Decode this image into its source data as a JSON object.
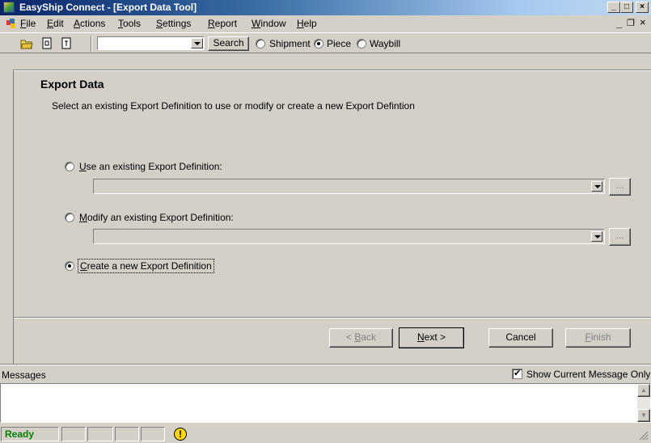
{
  "window": {
    "title": "EasyShip Connect - [Export Data Tool]"
  },
  "menu": {
    "items": [
      {
        "label": "File",
        "u": "F",
        "rest": "ile"
      },
      {
        "label": "Edit",
        "u": "E",
        "rest": "dit"
      },
      {
        "label": "Actions",
        "u": "A",
        "rest": "ctions"
      },
      {
        "label": "Tools",
        "u": "T",
        "rest": "ools"
      },
      {
        "label": "Settings",
        "u": "S",
        "rest": "ettings"
      },
      {
        "label": "Report",
        "u": "R",
        "rest": "eport"
      },
      {
        "label": "Window",
        "u": "W",
        "rest": "indow"
      },
      {
        "label": "Help",
        "u": "H",
        "rest": "elp"
      }
    ]
  },
  "toolbar": {
    "search_value": "",
    "search_label": "Search",
    "radios": [
      {
        "label": "Shipment",
        "selected": false
      },
      {
        "label": "Piece",
        "selected": true
      },
      {
        "label": "Waybill",
        "selected": false
      }
    ]
  },
  "export": {
    "heading": "Export Data",
    "instruction": "Select an existing Export Definition to use or modify or create a new Export Defintion",
    "options": [
      {
        "u": "U",
        "rest": "se an existing Export Definition:",
        "selected": false,
        "combo_value": ""
      },
      {
        "u": "M",
        "rest": "odify an existing Export Definition:",
        "selected": false,
        "combo_value": ""
      },
      {
        "u": "C",
        "rest": "reate a new Export Definition",
        "selected": true
      }
    ],
    "ellipsis": "...",
    "back_prefix": "< ",
    "back_u": "B",
    "back_rest": "ack",
    "next_u": "N",
    "next_rest": "ext >",
    "cancel_label": "Cancel",
    "finish_u": "F",
    "finish_rest": "inish"
  },
  "messages": {
    "label": "Messages",
    "show_current_label": "Show Current Message Only",
    "show_current_checked": true
  },
  "status": {
    "ready": "Ready",
    "warning_glyph": "!"
  },
  "colors": {
    "title_start": "#0a246a",
    "status_ready": "#008000",
    "warning_yellow": "#ffd800"
  }
}
